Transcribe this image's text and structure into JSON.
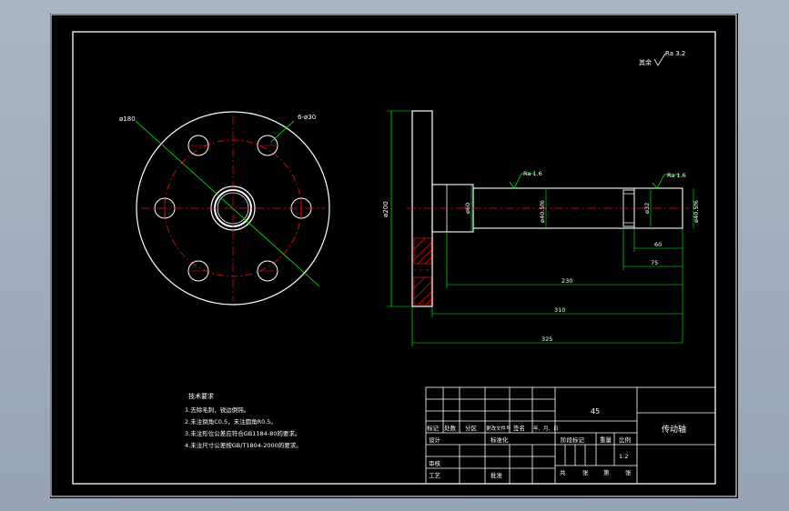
{
  "drawing": {
    "roughness_note": "Ra 3.2",
    "roughness_prefix": "其余",
    "flange": {
      "pcd_label": "ø180",
      "holes_label": "6-ø30"
    },
    "shaft": {
      "overall_dia_label": "ø200",
      "neck_dia_label": "ø60",
      "body_dia_label": "ø40.5f6",
      "end_dia_label": "ø40.5f6",
      "small_dia_label": "ø32",
      "roughness_1": "Ra 1.6",
      "roughness_2": "Ra 1.6",
      "dim_60": "60",
      "dim_75": "75",
      "dim_230": "230",
      "dim_310": "310",
      "dim_325": "325"
    },
    "tech_req": {
      "title": "技术要求",
      "lines": [
        "1.去除毛刺，锐边倒钝。",
        "2.未注倒角C0.5，未注圆角R0.5。",
        "3.未注形位公差应符合GB1184-80的要求。",
        "4.未注尺寸公差按GB/T1804-2000的要求。"
      ]
    },
    "title_block": {
      "material": "45",
      "part_name": "传动轴",
      "row_labels": [
        "标记",
        "处数",
        "分区",
        "更改文件号",
        "签名",
        "年、月、日"
      ],
      "designer": "设计",
      "standardize": "标准化",
      "stage_mark": "阶段标记",
      "weight": "重量",
      "scale_label": "比例",
      "scale_value": "1:2",
      "review": "审核",
      "process": "工艺",
      "approve": "批准",
      "sheet_total": "共",
      "sheet_word": "张",
      "sheet_no": "第",
      "sheet_word2": "张"
    }
  }
}
